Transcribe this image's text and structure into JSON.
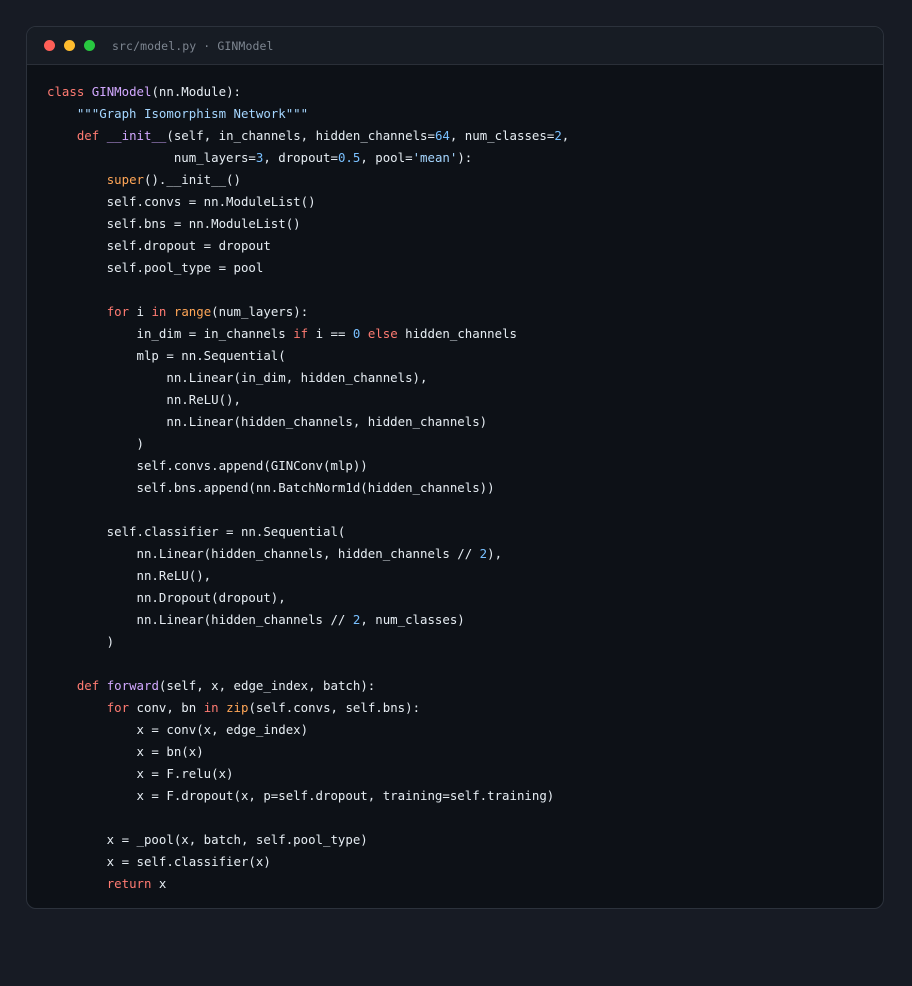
{
  "window": {
    "title": "src/model.py · GINModel",
    "traffic_lights": {
      "close_color": "#ff5f57",
      "minimize_color": "#febc2e",
      "maximize_color": "#28c840"
    }
  },
  "theme": {
    "background": "#171b24",
    "editor_background": "#0d1117",
    "text": "#e6edf3",
    "keyword": "#ff7b72",
    "function_name": "#d2a8ff",
    "builtin": "#ffa657",
    "number": "#79c0ff",
    "string": "#a5d6ff"
  },
  "code": {
    "language": "python",
    "lines": [
      [
        {
          "t": "class",
          "c": "kw"
        },
        {
          "t": " "
        },
        {
          "t": "GINModel",
          "c": "cls"
        },
        {
          "t": "(nn.Module):"
        }
      ],
      [
        {
          "t": "    "
        },
        {
          "t": "\"\"\"Graph Isomorphism Network\"\"\"",
          "c": "str"
        }
      ],
      [
        {
          "t": "    "
        },
        {
          "t": "def",
          "c": "kw"
        },
        {
          "t": " "
        },
        {
          "t": "__init__",
          "c": "fn"
        },
        {
          "t": "(self, in_channels, hidden_channels="
        },
        {
          "t": "64",
          "c": "num"
        },
        {
          "t": ", num_classes="
        },
        {
          "t": "2",
          "c": "num"
        },
        {
          "t": ","
        }
      ],
      [
        {
          "t": "                 num_layers="
        },
        {
          "t": "3",
          "c": "num"
        },
        {
          "t": ", dropout="
        },
        {
          "t": "0.5",
          "c": "num"
        },
        {
          "t": ", pool="
        },
        {
          "t": "'mean'",
          "c": "str"
        },
        {
          "t": "):"
        }
      ],
      [
        {
          "t": "        "
        },
        {
          "t": "super",
          "c": "bi"
        },
        {
          "t": "().__init__()"
        }
      ],
      [
        {
          "t": "        self.convs = nn.ModuleList()"
        }
      ],
      [
        {
          "t": "        self.bns = nn.ModuleList()"
        }
      ],
      [
        {
          "t": "        self.dropout = dropout"
        }
      ],
      [
        {
          "t": "        self.pool_type = pool"
        }
      ],
      [
        {
          "t": ""
        }
      ],
      [
        {
          "t": "        "
        },
        {
          "t": "for",
          "c": "kw"
        },
        {
          "t": " i "
        },
        {
          "t": "in",
          "c": "kw"
        },
        {
          "t": " "
        },
        {
          "t": "range",
          "c": "bi"
        },
        {
          "t": "(num_layers):"
        }
      ],
      [
        {
          "t": "            in_dim = in_channels "
        },
        {
          "t": "if",
          "c": "kw"
        },
        {
          "t": " i == "
        },
        {
          "t": "0",
          "c": "num"
        },
        {
          "t": " "
        },
        {
          "t": "else",
          "c": "kw"
        },
        {
          "t": " hidden_channels"
        }
      ],
      [
        {
          "t": "            mlp = nn.Sequential("
        }
      ],
      [
        {
          "t": "                nn.Linear(in_dim, hidden_channels),"
        }
      ],
      [
        {
          "t": "                nn.ReLU(),"
        }
      ],
      [
        {
          "t": "                nn.Linear(hidden_channels, hidden_channels)"
        }
      ],
      [
        {
          "t": "            )"
        }
      ],
      [
        {
          "t": "            self.convs.append(GINConv(mlp))"
        }
      ],
      [
        {
          "t": "            self.bns.append(nn.BatchNorm1d(hidden_channels))"
        }
      ],
      [
        {
          "t": ""
        }
      ],
      [
        {
          "t": "        self.classifier = nn.Sequential("
        }
      ],
      [
        {
          "t": "            nn.Linear(hidden_channels, hidden_channels // "
        },
        {
          "t": "2",
          "c": "num"
        },
        {
          "t": "),"
        }
      ],
      [
        {
          "t": "            nn.ReLU(),"
        }
      ],
      [
        {
          "t": "            nn.Dropout(dropout),"
        }
      ],
      [
        {
          "t": "            nn.Linear(hidden_channels // "
        },
        {
          "t": "2",
          "c": "num"
        },
        {
          "t": ", num_classes)"
        }
      ],
      [
        {
          "t": "        )"
        }
      ],
      [
        {
          "t": ""
        }
      ],
      [
        {
          "t": "    "
        },
        {
          "t": "def",
          "c": "kw"
        },
        {
          "t": " "
        },
        {
          "t": "forward",
          "c": "fn"
        },
        {
          "t": "(self, x, edge_index, batch):"
        }
      ],
      [
        {
          "t": "        "
        },
        {
          "t": "for",
          "c": "kw"
        },
        {
          "t": " conv, bn "
        },
        {
          "t": "in",
          "c": "kw"
        },
        {
          "t": " "
        },
        {
          "t": "zip",
          "c": "bi"
        },
        {
          "t": "(self.convs, self.bns):"
        }
      ],
      [
        {
          "t": "            x = conv(x, edge_index)"
        }
      ],
      [
        {
          "t": "            x = bn(x)"
        }
      ],
      [
        {
          "t": "            x = F.relu(x)"
        }
      ],
      [
        {
          "t": "            x = F.dropout(x, p=self.dropout, training=self.training)"
        }
      ],
      [
        {
          "t": ""
        }
      ],
      [
        {
          "t": "        x = _pool(x, batch, self.pool_type)"
        }
      ],
      [
        {
          "t": "        x = self.classifier(x)"
        }
      ],
      [
        {
          "t": "        "
        },
        {
          "t": "return",
          "c": "kw"
        },
        {
          "t": " x"
        }
      ]
    ]
  }
}
